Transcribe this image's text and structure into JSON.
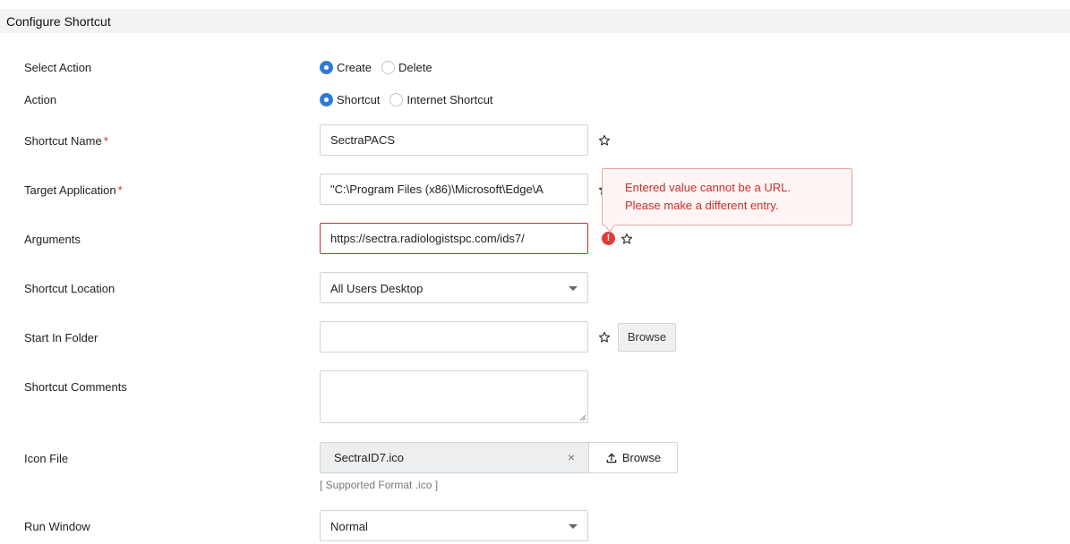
{
  "header": {
    "title": "Configure Shortcut"
  },
  "select_action": {
    "label": "Select Action",
    "options": [
      {
        "label": "Create",
        "checked": true
      },
      {
        "label": "Delete",
        "checked": false
      }
    ]
  },
  "action": {
    "label": "Action",
    "options": [
      {
        "label": "Shortcut",
        "checked": true
      },
      {
        "label": "Internet Shortcut",
        "checked": false
      }
    ]
  },
  "shortcut_name": {
    "label": "Shortcut Name",
    "required_mark": "*",
    "value": "SectraPACS"
  },
  "target_application": {
    "label": "Target Application",
    "required_mark": "*",
    "value": "\"C:\\Program Files (x86)\\Microsoft\\Edge\\A"
  },
  "arguments": {
    "label": "Arguments",
    "value": "https://sectra.radiologistspc.com/ids7/",
    "error_icon": "!",
    "error_message": "Entered value cannot be a URL. Please make a different entry."
  },
  "shortcut_location": {
    "label": "Shortcut Location",
    "selected": "All Users Desktop"
  },
  "start_in_folder": {
    "label": "Start In Folder",
    "value": "",
    "browse_label": "Browse"
  },
  "shortcut_comments": {
    "label": "Shortcut Comments",
    "value": ""
  },
  "icon_file": {
    "label": "Icon File",
    "file_name": "SectraID7.ico",
    "clear_symbol": "×",
    "browse_label": "Browse",
    "hint": "[ Supported Format .ico ]"
  },
  "run_window": {
    "label": "Run Window",
    "selected": "Normal"
  },
  "icons": {
    "favorite": "star-outline-icon",
    "upload": "upload-icon",
    "error": "error-icon"
  },
  "colors": {
    "accent": "#2e7bd6",
    "error": "#c9302c",
    "header_bg": "#f2f3f5"
  }
}
